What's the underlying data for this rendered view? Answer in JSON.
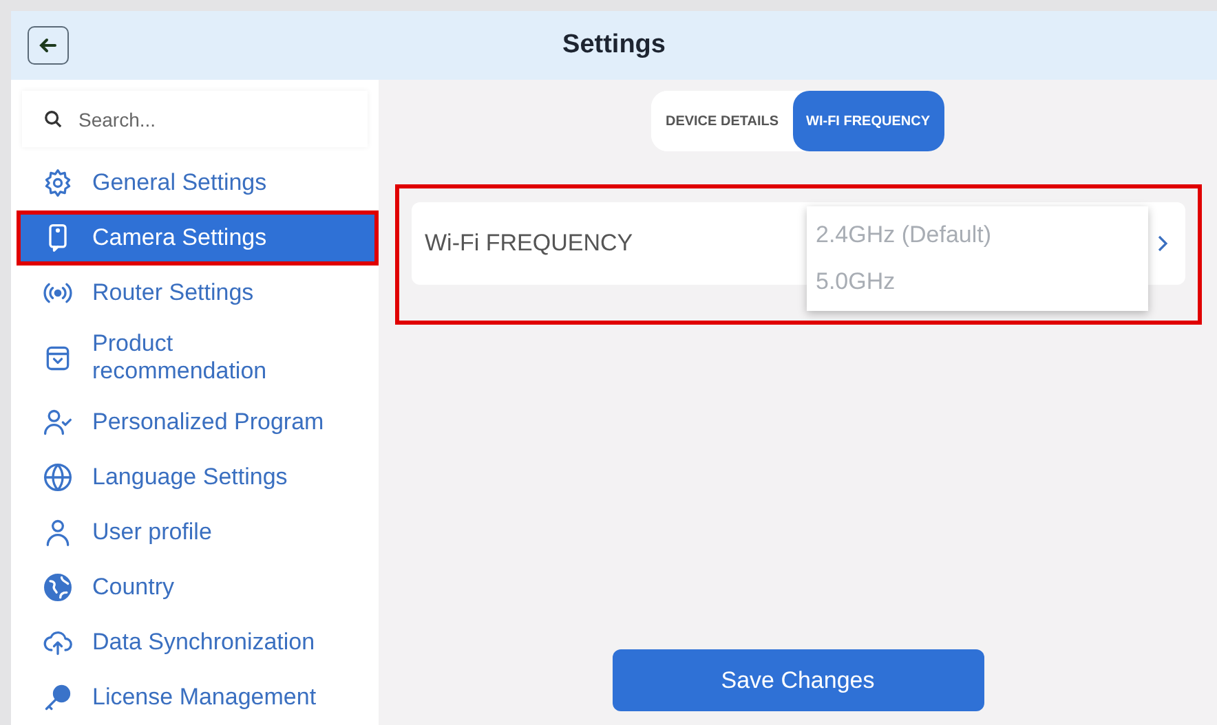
{
  "header": {
    "title": "Settings"
  },
  "sidebar": {
    "search": {
      "placeholder": "Search..."
    },
    "items": [
      {
        "label": "General Settings",
        "selected": false
      },
      {
        "label": "Camera Settings",
        "selected": true
      },
      {
        "label": "Router Settings",
        "selected": false
      },
      {
        "label": "Product recommendation",
        "selected": false
      },
      {
        "label": "Personalized Program",
        "selected": false
      },
      {
        "label": "Language Settings",
        "selected": false
      },
      {
        "label": "User profile",
        "selected": false
      },
      {
        "label": "Country",
        "selected": false
      },
      {
        "label": "Data Synchronization",
        "selected": false
      },
      {
        "label": "License Management",
        "selected": false
      }
    ]
  },
  "tabs": [
    {
      "label": "DEVICE DETAILS",
      "selected": false
    },
    {
      "label": "WI-FI FREQUENCY",
      "selected": true
    }
  ],
  "setting": {
    "label": "Wi-Fi FREQUENCY",
    "options": [
      {
        "label": "2.4GHz (Default)",
        "selected": false
      },
      {
        "label": "5.0GHz",
        "selected": false
      }
    ]
  },
  "save_button": "Save Changes"
}
